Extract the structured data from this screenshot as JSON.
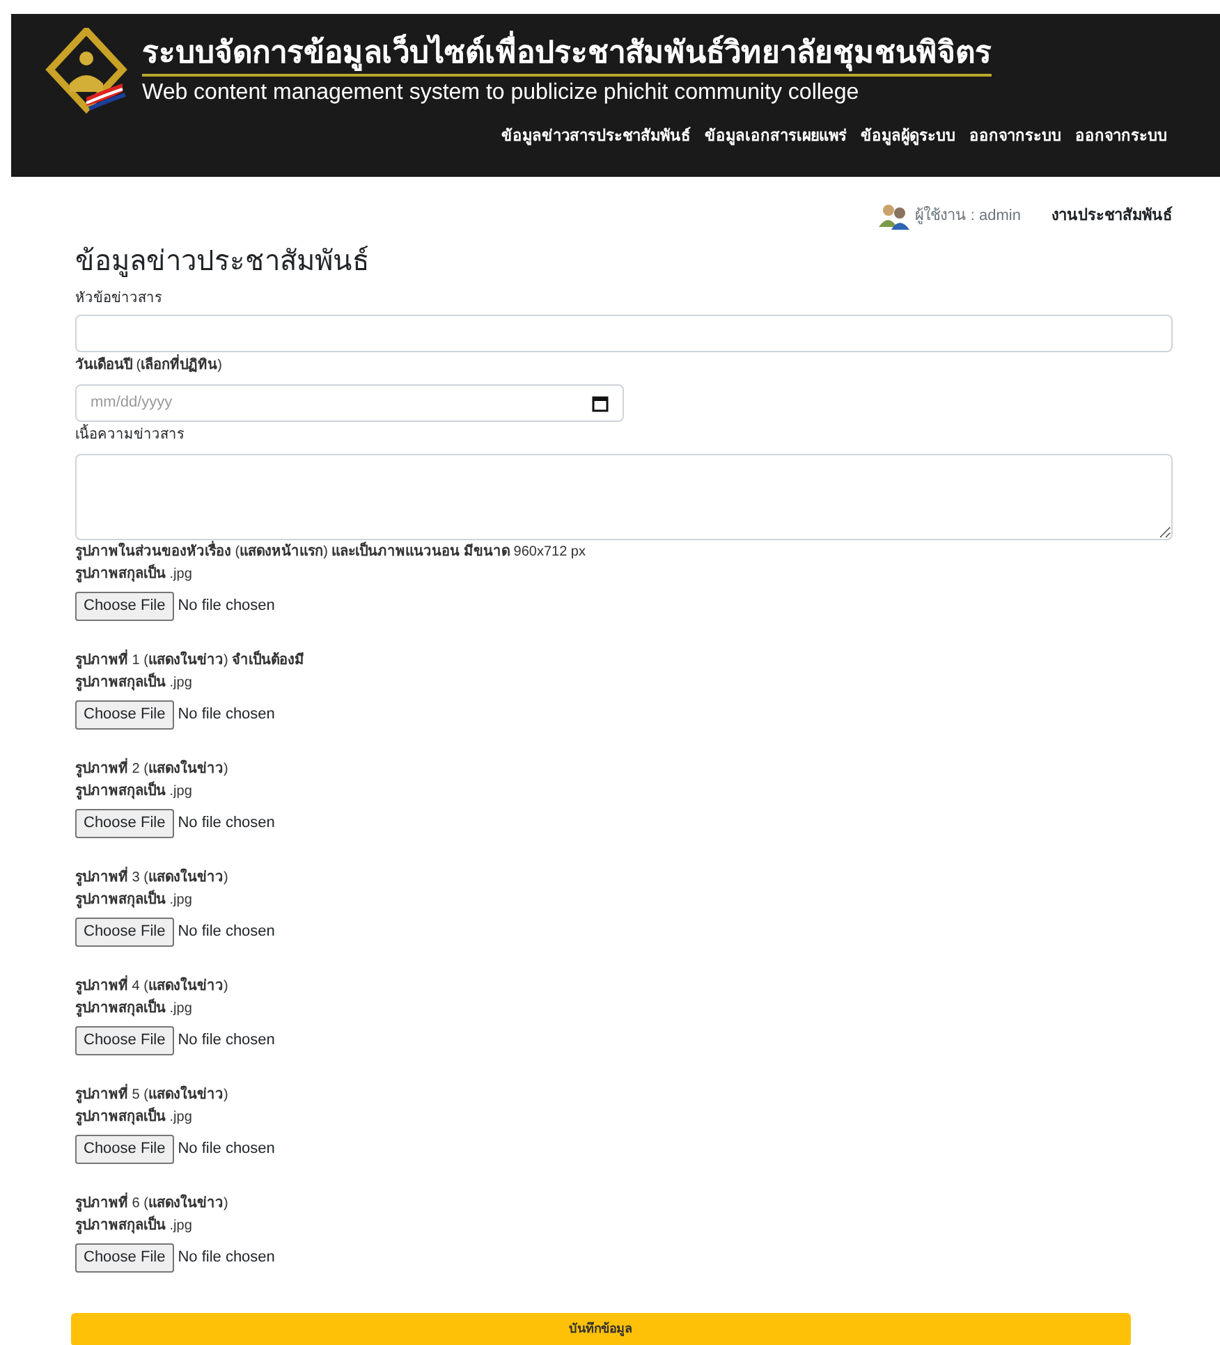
{
  "header": {
    "title_th": "ระบบจัดการข้อมูลเว็บไซต์เพื่อประชาสัมพันธ์วิทยาลัยชุมชนพิจิตร",
    "title_en": "Web content management system to publicize phichit community college"
  },
  "nav": [
    "ข้อมูลข่าวสารประชาสัมพันธ์",
    "ข้อมูลเอกสารเผยแพร่",
    "ข้อมูลผู้ดูระบบ",
    "ออกจากระบบ",
    "ออกจากระบบ"
  ],
  "user": {
    "label": "ผู้ใช้งาน : admin",
    "department": "งานประชาสัมพันธ์"
  },
  "form": {
    "heading": "ข้อมูลข่าวประชาสัมพันธ์",
    "title_label": "หัวข้อข่าวสาร",
    "date_label": "**วันเดือนปี** (**เลือกที่ปฏิทิน**)",
    "date_placeholder": "mm/dd/yyyy",
    "body_label": "เนื้อความข่าวสาร",
    "uploads": [
      {
        "label": "**รูปภาพในส่วนของหัวเรื่อง** (**แสดงหน้าแรก**) **และเป็นภาพแนวนอน มีขนาด** 960x712 px",
        "hint": "**รูปภาพสกุลเป็น** .jpg",
        "button": "Choose File",
        "status": "No file chosen"
      },
      {
        "label": "**รูปภาพที่** 1 (**แสดงในข่าว**) **จำเป็นต้องมี**",
        "hint": "**รูปภาพสกุลเป็น** .jpg",
        "button": "Choose File",
        "status": "No file chosen"
      },
      {
        "label": "**รูปภาพที่** 2 (**แสดงในข่าว**)",
        "hint": "**รูปภาพสกุลเป็น** .jpg",
        "button": "Choose File",
        "status": "No file chosen"
      },
      {
        "label": "**รูปภาพที่** 3 (**แสดงในข่าว**)",
        "hint": "**รูปภาพสกุลเป็น** .jpg",
        "button": "Choose File",
        "status": "No file chosen"
      },
      {
        "label": "**รูปภาพที่** 4 (**แสดงในข่าว**)",
        "hint": "**รูปภาพสกุลเป็น** .jpg",
        "button": "Choose File",
        "status": "No file chosen"
      },
      {
        "label": "**รูปภาพที่** 5 (**แสดงในข่าว**)",
        "hint": "**รูปภาพสกุลเป็น** .jpg",
        "button": "Choose File",
        "status": "No file chosen"
      },
      {
        "label": "**รูปภาพที่** 6 (**แสดงในข่าว**)",
        "hint": "**รูปภาพสกุลเป็น** .jpg",
        "button": "Choose File",
        "status": "No file chosen"
      }
    ],
    "submit": "บันทึกข้อมูล"
  }
}
